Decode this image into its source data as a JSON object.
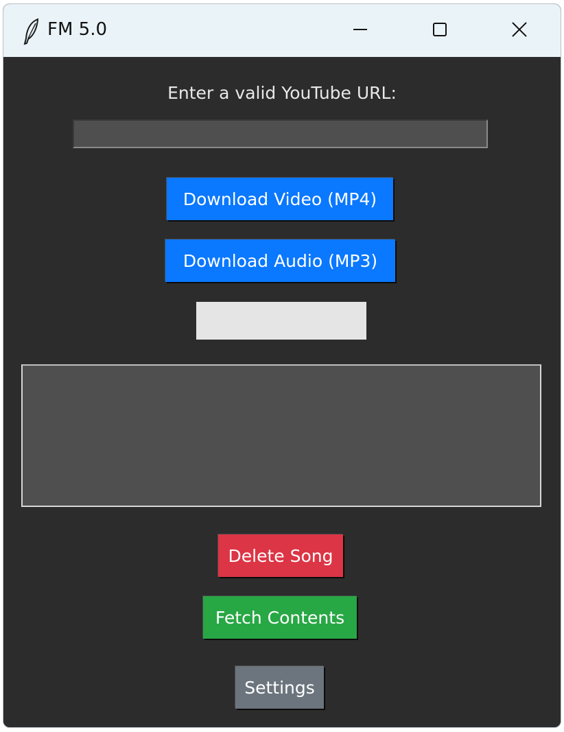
{
  "window": {
    "title": "FM 5.0",
    "app_icon": "feather-icon",
    "controls": {
      "minimize_icon": "minimize-icon",
      "maximize_icon": "maximize-icon",
      "close_icon": "close-icon"
    }
  },
  "main": {
    "prompt_label": "Enter a valid YouTube URL:",
    "url_input": {
      "value": "",
      "placeholder": ""
    },
    "buttons": {
      "download_video": "Download Video (MP4)",
      "download_audio": "Download Audio (MP3)",
      "delete_song": "Delete Song",
      "fetch_contents": "Fetch Contents",
      "settings": "Settings"
    },
    "status_text": "",
    "song_list": []
  },
  "colors": {
    "background": "#2c2c2c",
    "titlebar": "#eaf4f8",
    "download_button": "#0a78ff",
    "delete_button": "#dc3545",
    "fetch_button": "#28a745",
    "settings_button": "#6c757d",
    "input_background": "#4f4f4f",
    "status_box": "#e5e5e5"
  }
}
